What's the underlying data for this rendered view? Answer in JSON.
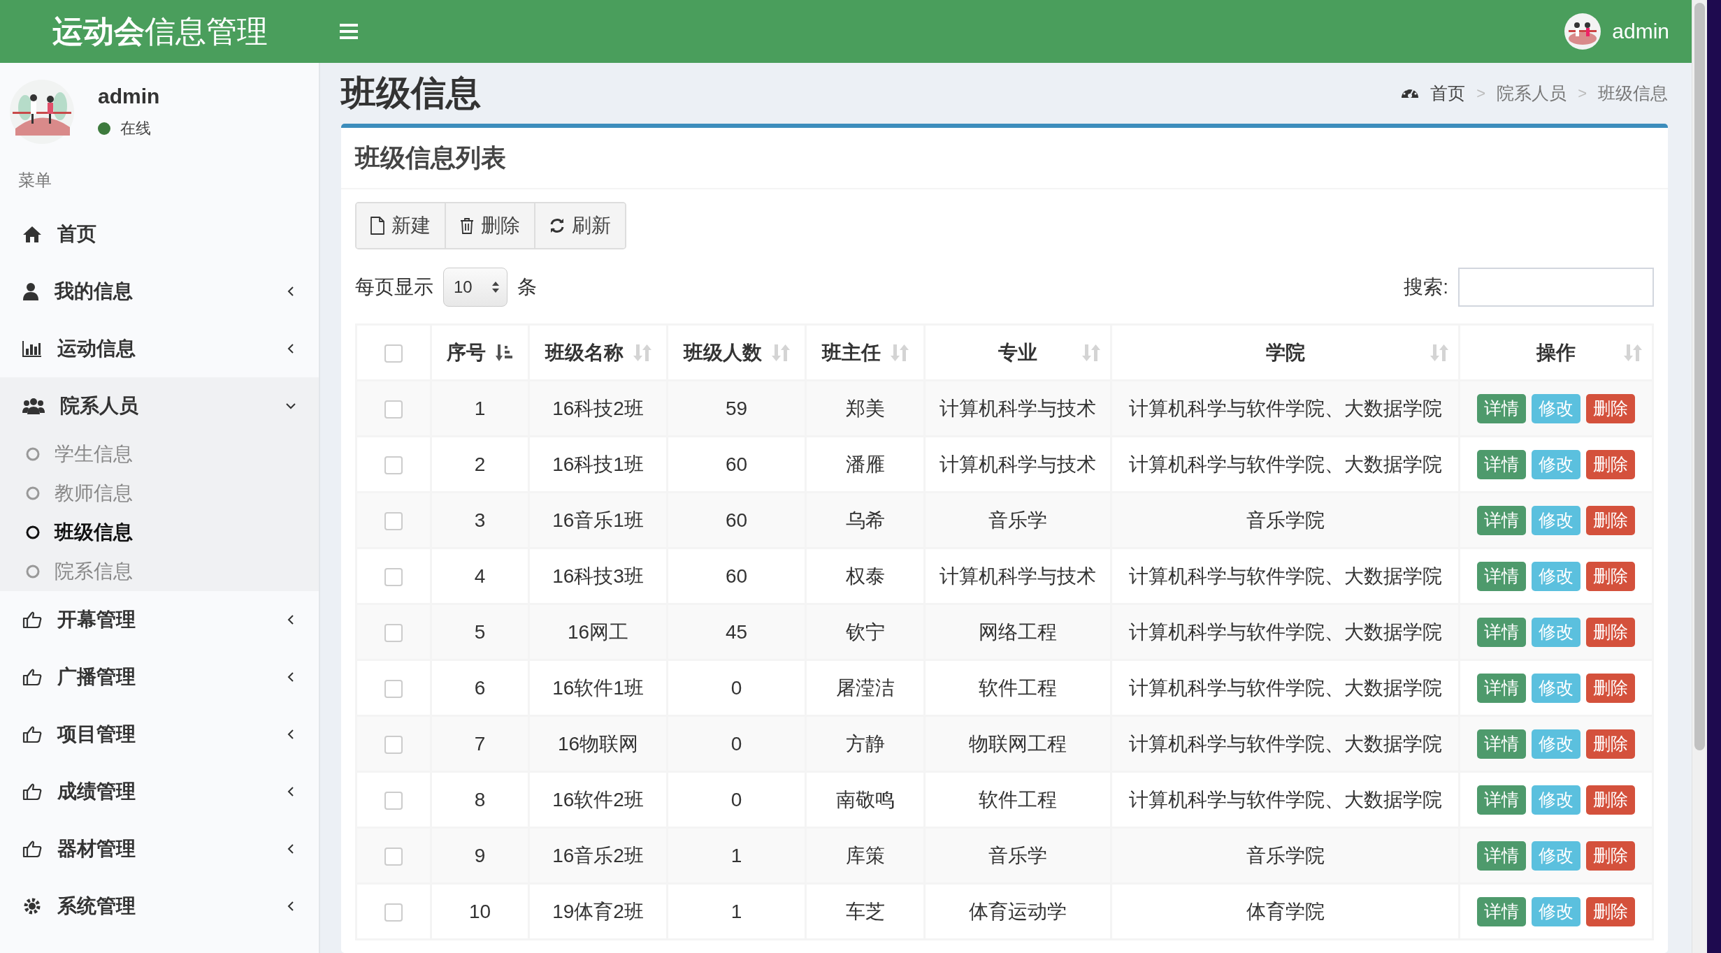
{
  "header": {
    "title": "**运动会**信息管理",
    "user": "admin"
  },
  "user_panel": {
    "name": "admin",
    "status": "在线",
    "online": true
  },
  "sidebar": {
    "header": "菜单",
    "items": [
      {
        "label": "首页",
        "kind": "link"
      },
      {
        "label": "我的信息",
        "kind": "menu",
        "expanded": false
      },
      {
        "label": "运动信息",
        "kind": "menu",
        "expanded": false
      },
      {
        "label": "院系人员",
        "kind": "menu",
        "expanded": true,
        "children": [
          {
            "label": "学生信息",
            "selected": false
          },
          {
            "label": "教师信息",
            "selected": false
          },
          {
            "label": "班级信息",
            "selected": true
          },
          {
            "label": "院系信息",
            "selected": false
          }
        ]
      },
      {
        "label": "开幕管理",
        "kind": "menu",
        "expanded": false
      },
      {
        "label": "广播管理",
        "kind": "menu",
        "expanded": false
      },
      {
        "label": "项目管理",
        "kind": "menu",
        "expanded": false
      },
      {
        "label": "成绩管理",
        "kind": "menu",
        "expanded": false
      },
      {
        "label": "器材管理",
        "kind": "menu",
        "expanded": false
      },
      {
        "label": "系统管理",
        "kind": "menu",
        "expanded": false
      }
    ]
  },
  "page": {
    "title": "班级信息",
    "breadcrumb": [
      "首页",
      ">",
      "院系人员",
      ">",
      "班级信息"
    ]
  },
  "panel": {
    "title": "班级信息列表",
    "toolbar": [
      "新建",
      "删除",
      "刷新"
    ],
    "page_size": {
      "before": "每页显示",
      "value": "10",
      "after": "条"
    },
    "search": {
      "label": "搜索:"
    },
    "table": {
      "header_checked": false,
      "columns": [
        {
          "label": "序号",
          "sorted": true
        },
        {
          "label": "班级名称",
          "sorted": false
        },
        {
          "label": "班级人数",
          "sorted": false
        },
        {
          "label": "班主任",
          "sorted": false
        },
        {
          "label": "专业",
          "sorted": false
        },
        {
          "label": "学院",
          "sorted": false
        },
        {
          "label": "操作",
          "sorted": false
        }
      ],
      "rows": [
        {
          "checked": false,
          "cells": [
            "1",
            "16科技2班",
            "59",
            "郑美",
            "计算机科学与技术",
            "计算机科学与软件学院、大数据学院"
          ],
          "actions": [
            {
              "label": "详情",
              "kind": "detail"
            },
            {
              "label": "修改",
              "kind": "edit"
            },
            {
              "label": "删除",
              "kind": "delete"
            }
          ]
        },
        {
          "checked": false,
          "cells": [
            "2",
            "16科技1班",
            "60",
            "潘雁",
            "计算机科学与技术",
            "计算机科学与软件学院、大数据学院"
          ],
          "actions": [
            {
              "label": "详情",
              "kind": "detail"
            },
            {
              "label": "修改",
              "kind": "edit"
            },
            {
              "label": "删除",
              "kind": "delete"
            }
          ]
        },
        {
          "checked": false,
          "cells": [
            "3",
            "16音乐1班",
            "60",
            "乌希",
            "音乐学",
            "音乐学院"
          ],
          "actions": [
            {
              "label": "详情",
              "kind": "detail"
            },
            {
              "label": "修改",
              "kind": "edit"
            },
            {
              "label": "删除",
              "kind": "delete"
            }
          ]
        },
        {
          "checked": false,
          "cells": [
            "4",
            "16科技3班",
            "60",
            "权泰",
            "计算机科学与技术",
            "计算机科学与软件学院、大数据学院"
          ],
          "actions": [
            {
              "label": "详情",
              "kind": "detail"
            },
            {
              "label": "修改",
              "kind": "edit"
            },
            {
              "label": "删除",
              "kind": "delete"
            }
          ]
        },
        {
          "checked": false,
          "cells": [
            "5",
            "16网工",
            "45",
            "钦宁",
            "网络工程",
            "计算机科学与软件学院、大数据学院"
          ],
          "actions": [
            {
              "label": "详情",
              "kind": "detail"
            },
            {
              "label": "修改",
              "kind": "edit"
            },
            {
              "label": "删除",
              "kind": "delete"
            }
          ]
        },
        {
          "checked": false,
          "cells": [
            "6",
            "16软件1班",
            "0",
            "屠滢洁",
            "软件工程",
            "计算机科学与软件学院、大数据学院"
          ],
          "actions": [
            {
              "label": "详情",
              "kind": "detail"
            },
            {
              "label": "修改",
              "kind": "edit"
            },
            {
              "label": "删除",
              "kind": "delete"
            }
          ]
        },
        {
          "checked": false,
          "cells": [
            "7",
            "16物联网",
            "0",
            "方静",
            "物联网工程",
            "计算机科学与软件学院、大数据学院"
          ],
          "actions": [
            {
              "label": "详情",
              "kind": "detail"
            },
            {
              "label": "修改",
              "kind": "edit"
            },
            {
              "label": "删除",
              "kind": "delete"
            }
          ]
        },
        {
          "checked": false,
          "cells": [
            "8",
            "16软件2班",
            "0",
            "南敬鸣",
            "软件工程",
            "计算机科学与软件学院、大数据学院"
          ],
          "actions": [
            {
              "label": "详情",
              "kind": "detail"
            },
            {
              "label": "修改",
              "kind": "edit"
            },
            {
              "label": "删除",
              "kind": "delete"
            }
          ]
        },
        {
          "checked": false,
          "cells": [
            "9",
            "16音乐2班",
            "1",
            "库策",
            "音乐学",
            "音乐学院"
          ],
          "actions": [
            {
              "label": "详情",
              "kind": "detail"
            },
            {
              "label": "修改",
              "kind": "edit"
            },
            {
              "label": "删除",
              "kind": "delete"
            }
          ]
        },
        {
          "checked": false,
          "cells": [
            "10",
            "19体育2班",
            "1",
            "车芝",
            "体育运动学",
            "体育学院"
          ],
          "actions": [
            {
              "label": "详情",
              "kind": "detail"
            },
            {
              "label": "修改",
              "kind": "edit"
            },
            {
              "label": "删除",
              "kind": "delete"
            }
          ]
        }
      ]
    }
  }
}
